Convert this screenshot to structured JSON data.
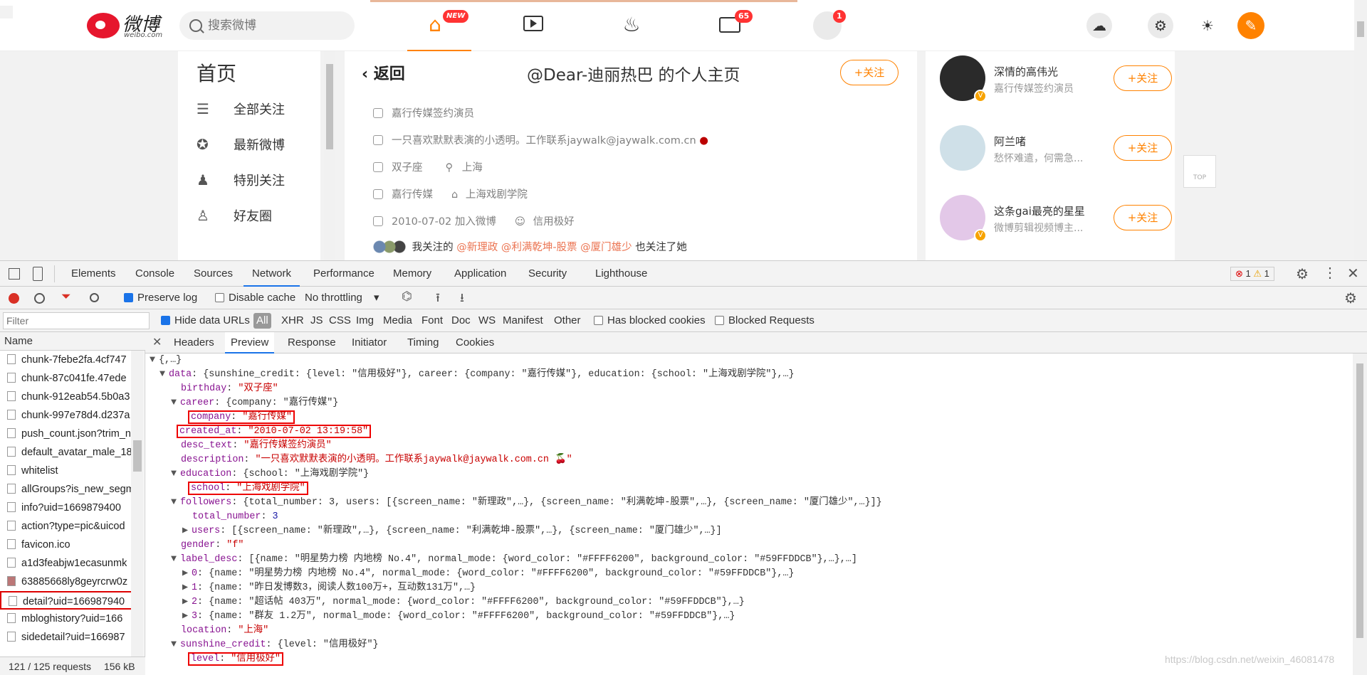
{
  "weibo": {
    "logo_text": "微博",
    "logo_sub": "weibo.com",
    "search_placeholder": "搜索微博",
    "nav": {
      "home_badge": "NEW",
      "msg_badge": "65",
      "profile_badge": "1"
    },
    "left_nav": {
      "title": "首页",
      "items": [
        {
          "label": "全部关注"
        },
        {
          "label": "最新微博"
        },
        {
          "label": "特别关注"
        },
        {
          "label": "好友圈"
        }
      ]
    },
    "profile": {
      "back_label": "返回",
      "title": "@Dear-迪丽热巴 的个人主页",
      "follow_label": "+关注",
      "desc_text": "嘉行传媒签约演员",
      "description": "一只喜欢默默表演的小透明。工作联系jaywalk@jaywalk.com.cn",
      "birthday": "双子座",
      "location": "上海",
      "company": "嘉行传媒",
      "school": "上海戏剧学院",
      "joined": "2010-07-02 加入微博",
      "credit": "信用极好",
      "mutual_prefix": "我关注的",
      "mutual_users": [
        "@新理政",
        "@利满乾坤-股票",
        "@厦门雄少"
      ],
      "mutual_suffix": "也关注了她"
    },
    "recommendations": [
      {
        "name": "深情的高伟光",
        "desc": "嘉行传媒签约演员",
        "follow": "+关注"
      },
      {
        "name": "阿兰啫",
        "desc": "愁怀难遣，何需急...",
        "follow": "+关注"
      },
      {
        "name": "这条gai最亮的星星",
        "desc": "微博剪辑视频博主...",
        "follow": "+关注"
      }
    ],
    "top_label": "TOP"
  },
  "devtools": {
    "tabs": [
      "Elements",
      "Console",
      "Sources",
      "Network",
      "Performance",
      "Memory",
      "Application",
      "Security",
      "Lighthouse"
    ],
    "active_tab": "Network",
    "error_count": "1",
    "warning_count": "1",
    "toolbar": {
      "preserve_log": "Preserve log",
      "disable_cache": "Disable cache",
      "throttling": "No throttling"
    },
    "filter": {
      "placeholder": "Filter",
      "hide_data_urls": "Hide data URLs",
      "types": [
        "All",
        "XHR",
        "JS",
        "CSS",
        "Img",
        "Media",
        "Font",
        "Doc",
        "WS",
        "Manifest",
        "Other"
      ],
      "has_blocked_cookies": "Has blocked cookies",
      "blocked_requests": "Blocked Requests"
    },
    "requests": {
      "header": "Name",
      "items": [
        "chunk-7febe2fa.4cf747",
        "chunk-87c041fe.47ede",
        "chunk-912eab54.5b0a3",
        "chunk-997e78d4.d237a",
        "push_count.json?trim_n",
        "default_avatar_male_18",
        "whitelist",
        "allGroups?is_new_segm",
        "info?uid=1669879400",
        "action?type=pic&uicod",
        "favicon.ico",
        "a1d3feabjw1ecasunmk",
        "63885668ly8geyrcrw0z",
        "detail?uid=166987940",
        "mbloghistory?uid=166",
        "sidedetail?uid=166987"
      ],
      "status": "121 / 125 requests",
      "size": "156 kB"
    },
    "detail_tabs": [
      "Headers",
      "Preview",
      "Response",
      "Initiator",
      "Timing",
      "Cookies"
    ],
    "active_detail_tab": "Preview",
    "json": {
      "root": "{,…}",
      "data_summary": "{sunshine_credit: {level: \"信用极好\"}, career: {company: \"嘉行传媒\"}, education: {school: \"上海戏剧学院\"},…}",
      "birthday": "\"双子座\"",
      "career_summary": "{company: \"嘉行传媒\"}",
      "company": "\"嘉行传媒\"",
      "created_at": "\"2010-07-02 13:19:58\"",
      "desc_text": "\"嘉行传媒签约演员\"",
      "description": "\"一只喜欢默默表演的小透明。工作联系jaywalk@jaywalk.com.cn 🍒\"",
      "education_summary": "{school: \"上海戏剧学院\"}",
      "school": "\"上海戏剧学院\"",
      "followers_summary": "{total_number: 3, users: [{screen_name: \"新理政\",…}, {screen_name: \"利满乾坤-股票\",…}, {screen_name: \"厦门雄少\",…}]}",
      "total_number": "3",
      "users_summary": "[{screen_name: \"新理政\",…}, {screen_name: \"利满乾坤-股票\",…}, {screen_name: \"厦门雄少\",…}]",
      "gender": "\"f\"",
      "label_desc_summary": "[{name: \"明星势力榜 内地榜 No.4\", normal_mode: {word_color: \"#FFFF6200\", background_color: \"#59FFDDCB\"},…},…]",
      "label_items": [
        "{name: \"明星势力榜 内地榜 No.4\", normal_mode: {word_color: \"#FFFF6200\", background_color: \"#59FFDDCB\"},…}",
        "{name: \"昨日发博数3，阅读人数100万+，互动数131万\",…}",
        "{name: \"超话帖 403万\", normal_mode: {word_color: \"#FFFF6200\", background_color: \"#59FFDDCB\"},…}",
        "{name: \"群友 1.2万\", normal_mode: {word_color: \"#FFFF6200\", background_color: \"#59FFDDCB\"},…}"
      ],
      "location": "\"上海\"",
      "sunshine_summary": "{level: \"信用极好\"}",
      "level": "\"信用极好\""
    },
    "watermark": "https://blog.csdn.net/weixin_46081478"
  },
  "colors": {
    "weibo_orange": "#ff8200",
    "json_key": "#881391",
    "json_string": "#c80000",
    "highlight_box": "#e00000"
  }
}
